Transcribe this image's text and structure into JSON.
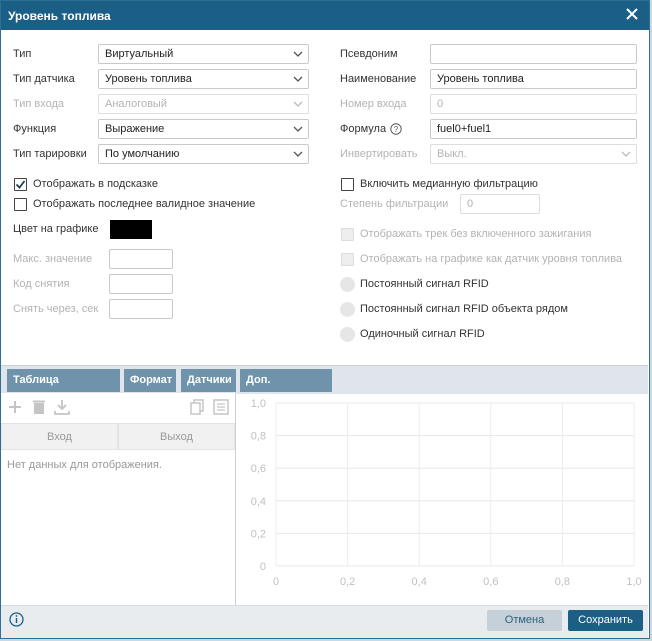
{
  "dialog": {
    "title": "Уровень топлива"
  },
  "left_form": {
    "type": {
      "label": "Тип",
      "value": "Виртуальный"
    },
    "sensor_type": {
      "label": "Тип датчика",
      "value": "Уровень топлива"
    },
    "input_type": {
      "label": "Тип входа",
      "value": "Аналоговый"
    },
    "function": {
      "label": "Функция",
      "value": "Выражение"
    },
    "calibration_type": {
      "label": "Тип тарировки",
      "value": "По умолчанию"
    },
    "show_in_tooltip": {
      "label": "Отображать в подсказке",
      "checked": true
    },
    "show_last_valid": {
      "label": "Отображать последнее валидное значение",
      "checked": false
    },
    "chart_color": {
      "label": "Цвет на графике",
      "color": "#000000"
    },
    "max_value": {
      "label": "Макс. значение",
      "value": ""
    },
    "removal_code": {
      "label": "Код снятия",
      "value": ""
    },
    "remove_after": {
      "label": "Снять через, сек",
      "value": ""
    }
  },
  "right_form": {
    "alias": {
      "label": "Псевдоним",
      "value": ""
    },
    "name": {
      "label": "Наименование",
      "value": "Уровень топлива"
    },
    "input_number": {
      "label": "Номер входа",
      "value": "0"
    },
    "formula": {
      "label": "Формула",
      "value": "fuel0+fuel1"
    },
    "invert": {
      "label": "Инвертировать",
      "value": "Выкл."
    },
    "median_filter": {
      "label": "Включить медианную фильтрацию",
      "checked": false
    },
    "filter_degree": {
      "label": "Степень фильтрации",
      "value": "0"
    },
    "track_without_ignition": {
      "label": "Отображать трек без включенного зажигания"
    },
    "chart_as_fuel": {
      "label": "Отображать на графике как датчик уровня топлива"
    },
    "rfid_constant": {
      "label": "Постоянный сигнал RFID"
    },
    "rfid_constant_nearby": {
      "label": "Постоянный сигнал RFID объекта рядом"
    },
    "rfid_single": {
      "label": "Одиночный сигнал RFID"
    }
  },
  "tabs": [
    {
      "label": "Таблица тарировки"
    },
    {
      "label": "Формат"
    },
    {
      "label": "Датчики"
    },
    {
      "label": "Доп. настройки"
    }
  ],
  "table": {
    "columns": [
      "Вход",
      "Выход"
    ],
    "empty_text": "Нет данных для отображения."
  },
  "chart_data": {
    "type": "line",
    "series": [],
    "x_ticks": [
      "0",
      "0,2",
      "0,4",
      "0,6",
      "0,8",
      "1,0"
    ],
    "y_ticks": [
      "0",
      "0,2",
      "0,4",
      "0,6",
      "0,8",
      "1,0"
    ],
    "xlim": [
      0,
      1
    ],
    "ylim": [
      0,
      1
    ],
    "grid": true
  },
  "footer": {
    "cancel_label": "Отмена",
    "save_label": "Сохранить"
  },
  "colors": {
    "header": "#1c5f86",
    "tab": "#6e93aa",
    "save": "#1c5f86"
  }
}
